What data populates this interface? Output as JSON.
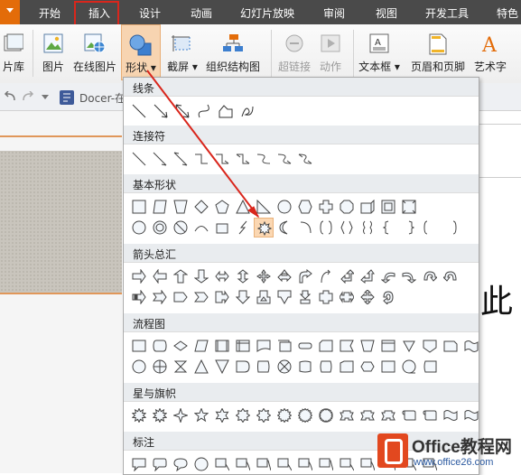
{
  "tabs": [
    "开始",
    "插入",
    "设计",
    "动画",
    "幻灯片放映",
    "审阅",
    "视图",
    "开发工具",
    "特色"
  ],
  "active_tab": "插入",
  "ribbon": {
    "picture_library": "片库",
    "picture": "图片",
    "online_picture": "在线图片",
    "shapes": "形状",
    "screenshot": "截屏",
    "org_chart": "组织结构图",
    "hyperlink": "超链接",
    "action": "动作",
    "textbox": "文本框",
    "header_footer": "页眉和页脚",
    "wordart": "艺术字"
  },
  "doc_tab": "Docer-在",
  "slide_text": "此",
  "dropdown": {
    "sections": [
      "线条",
      "连接符",
      "基本形状",
      "箭头总汇",
      "流程图",
      "星与旗帜",
      "标注"
    ]
  },
  "watermark": {
    "title": "Office教程网",
    "url": "www.office26.com"
  },
  "colors": {
    "accent": "#e36c09",
    "highlight_box": "#d9261c",
    "arrow": "#d9261c"
  }
}
